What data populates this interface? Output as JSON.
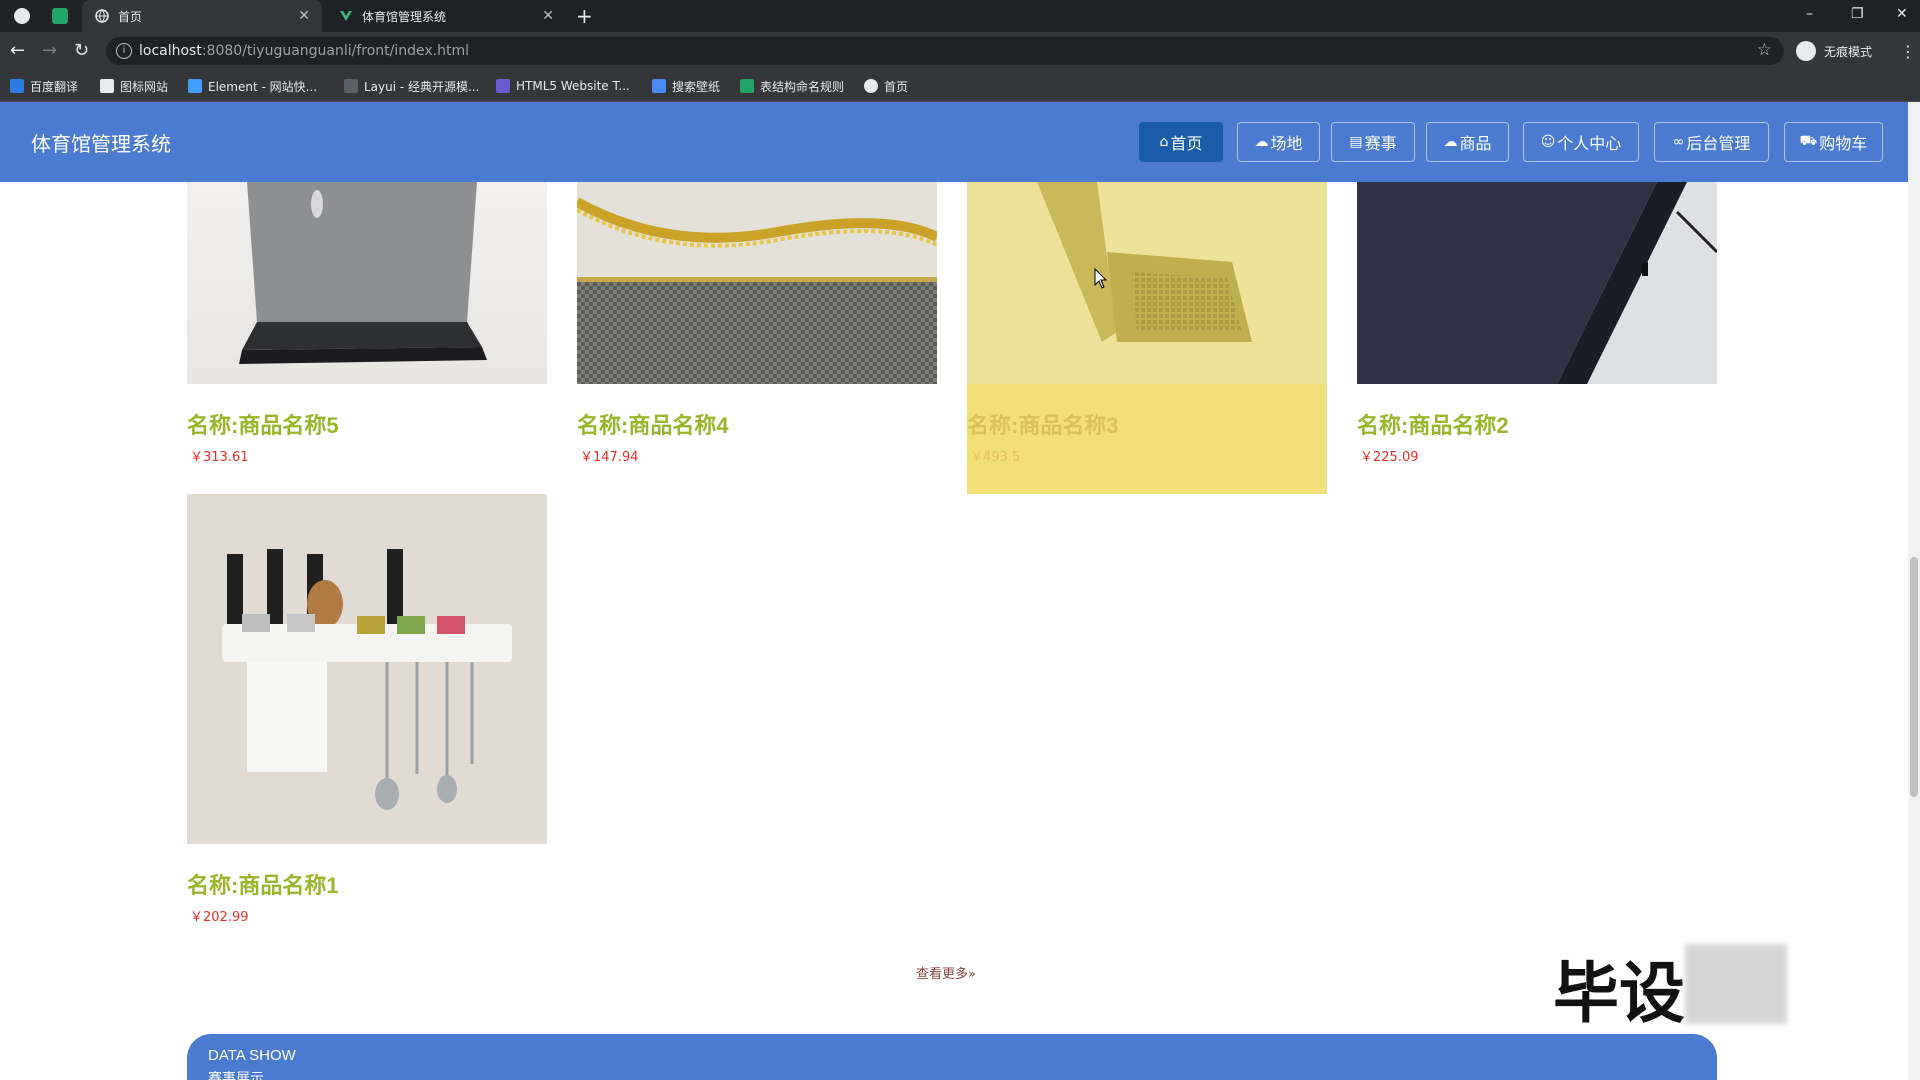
{
  "browser": {
    "tabs": [
      {
        "title": "首页",
        "active": true
      },
      {
        "title": "体育馆管理系统",
        "active": false
      }
    ],
    "url_host": "localhost",
    "url_path": ":8080/tiyuguanguanli/front/index.html",
    "profile_label": "无痕模式",
    "bookmarks": [
      "百度翻译",
      "图标网站",
      "Element - 网站快...",
      "Layui - 经典开源模...",
      "HTML5 Website T...",
      "搜索壁纸",
      "表结构命名规则",
      "首页"
    ]
  },
  "header": {
    "site_title": "体育馆管理系统",
    "nav": [
      {
        "label": "首页",
        "icon": "home-icon"
      },
      {
        "label": "场地",
        "icon": "cloud-icon"
      },
      {
        "label": "赛事",
        "icon": "calendar-icon"
      },
      {
        "label": "商品",
        "icon": "cloud-icon"
      },
      {
        "label": "个人中心",
        "icon": "user-icon"
      },
      {
        "label": "后台管理",
        "icon": "link-icon"
      },
      {
        "label": "购物车",
        "icon": "cart-icon"
      }
    ],
    "active_nav": "首页"
  },
  "products": [
    {
      "name": "名称:商品名称5",
      "price": "￥313.61",
      "image": "laptop-photo"
    },
    {
      "name": "名称:商品名称4",
      "price": "￥147.94",
      "image": "gold-chain-photo"
    },
    {
      "name": "名称:商品名称3",
      "price": "￥493.5",
      "image": "laptop-keyboard-photo",
      "hovered": true
    },
    {
      "name": "名称:商品名称2",
      "price": "￥225.09",
      "image": "dark-laptop-photo"
    },
    {
      "name": "名称:商品名称1",
      "price": "￥202.99",
      "image": "kitchen-rack-photo"
    }
  ],
  "more_link": "查看更多",
  "data_show": {
    "title": "DATA SHOW",
    "subtitle": "赛事展示"
  },
  "watermark": "毕设",
  "colors": {
    "header_blue": "#4a7bd0",
    "active_nav": "#1a5ca8",
    "product_name": "#9bb52b",
    "price_red": "#e0312a",
    "hover_yellow": "#f2df7a"
  }
}
